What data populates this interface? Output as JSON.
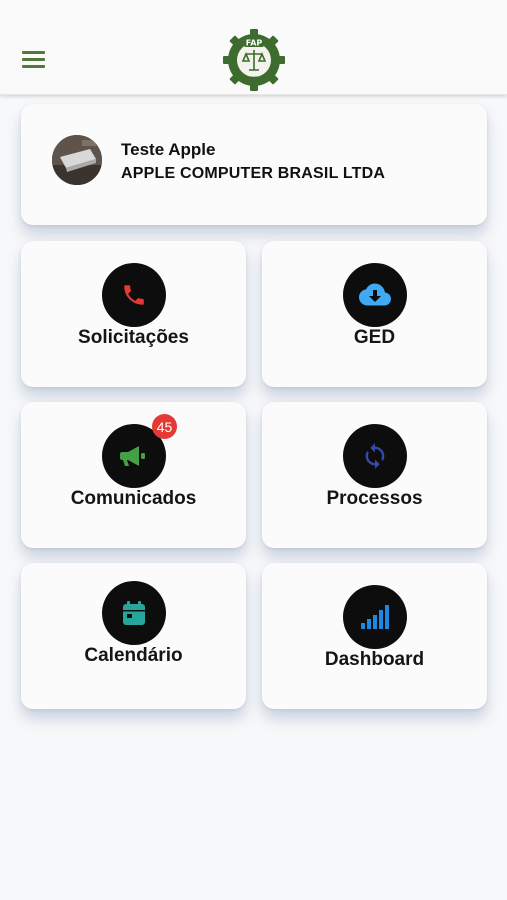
{
  "header": {
    "menu_icon": "hamburger-menu-icon",
    "logo_icon": "company-logo-gear",
    "logo_text": "FAP",
    "accent": "#4f7a3a"
  },
  "profile": {
    "avatar_icon": "avatar-photo",
    "name": "Teste Apple",
    "company": "APPLE COMPUTER BRASIL LTDA"
  },
  "tiles": [
    {
      "label": "Solicitações",
      "icon": "phone-icon",
      "icon_color": "#e53935"
    },
    {
      "label": "GED",
      "icon": "cloud-download-icon",
      "icon_color": "#3fa9f5"
    },
    {
      "label": "Comunicados",
      "icon": "megaphone-icon",
      "icon_color": "#43a047",
      "badge": "45"
    },
    {
      "label": "Processos",
      "icon": "sync-icon",
      "icon_color": "#3949ab"
    },
    {
      "label": "Calendário",
      "icon": "calendar-icon",
      "icon_color": "#26a69a"
    },
    {
      "label": "Dashboard",
      "icon": "signal-bars-icon",
      "icon_color": "#1e88e5"
    }
  ]
}
